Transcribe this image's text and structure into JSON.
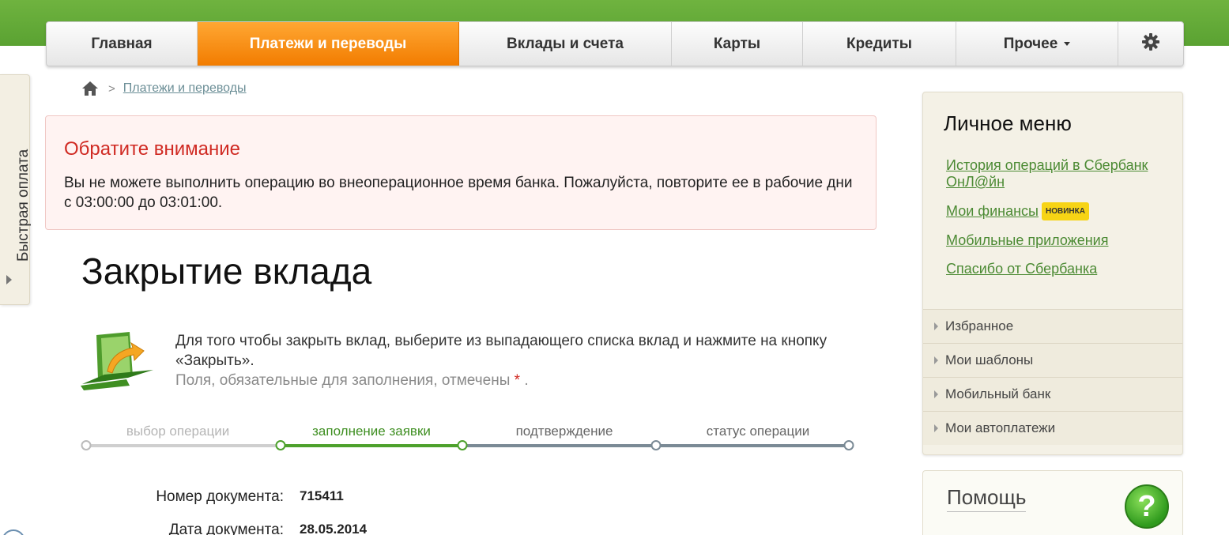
{
  "nav": {
    "items": [
      {
        "label": "Главная"
      },
      {
        "label": "Платежи и переводы"
      },
      {
        "label": "Вклады и счета"
      },
      {
        "label": "Карты"
      },
      {
        "label": "Кредиты"
      },
      {
        "label": "Прочее"
      }
    ],
    "active_index": 1,
    "settings_icon": "gear-icon"
  },
  "quick_pay": {
    "label": "Быстрая оплата"
  },
  "breadcrumb": {
    "home_icon": "home-icon",
    "current": "Платежи и переводы"
  },
  "alert": {
    "title": "Обратите внимание",
    "text": "Вы не можете выполнить операцию во внеоперационное время банка. Пожалуйста, повторите ее в рабочие дни с 03:00:00 до 03:01:00."
  },
  "page": {
    "title": "Закрытие вклада",
    "instructions": "Для того чтобы закрыть вклад, выберите из выпадающего списка вклад и нажмите на кнопку «Закрыть».",
    "required_hint": "Поля, обязательные для заполнения, отмечены",
    "required_mark": "*",
    "required_end": "."
  },
  "steps": [
    {
      "label": "выбор операции",
      "state": "done"
    },
    {
      "label": "заполнение заявки",
      "state": "current"
    },
    {
      "label": "подтверждение",
      "state": "pending"
    },
    {
      "label": "статус операции",
      "state": "pending"
    }
  ],
  "fields": [
    {
      "label": "Номер документа:",
      "value": "715411"
    },
    {
      "label": "Дата документа:",
      "value": "28.05.2014"
    }
  ],
  "personal_menu": {
    "title": "Личное меню",
    "links": [
      {
        "label": "История операций в Сбербанк ОнЛ@йн"
      },
      {
        "label": "Мои финансы",
        "badge": "НОВИНКА"
      },
      {
        "label": "Мобильные приложения"
      },
      {
        "label": "Спасибо от Сбербанка"
      }
    ],
    "sections": [
      {
        "label": "Избранное"
      },
      {
        "label": "Мои шаблоны"
      },
      {
        "label": "Мобильный банк"
      },
      {
        "label": "Мои автоплатежи"
      }
    ]
  },
  "help": {
    "title": "Помощь",
    "icon": "question-icon",
    "icon_glyph": "?"
  },
  "colors": {
    "brand_green": "#5aa232",
    "active_tab": "#f27c00",
    "alert_red": "#d02a23",
    "link_green": "#4b8a33"
  }
}
